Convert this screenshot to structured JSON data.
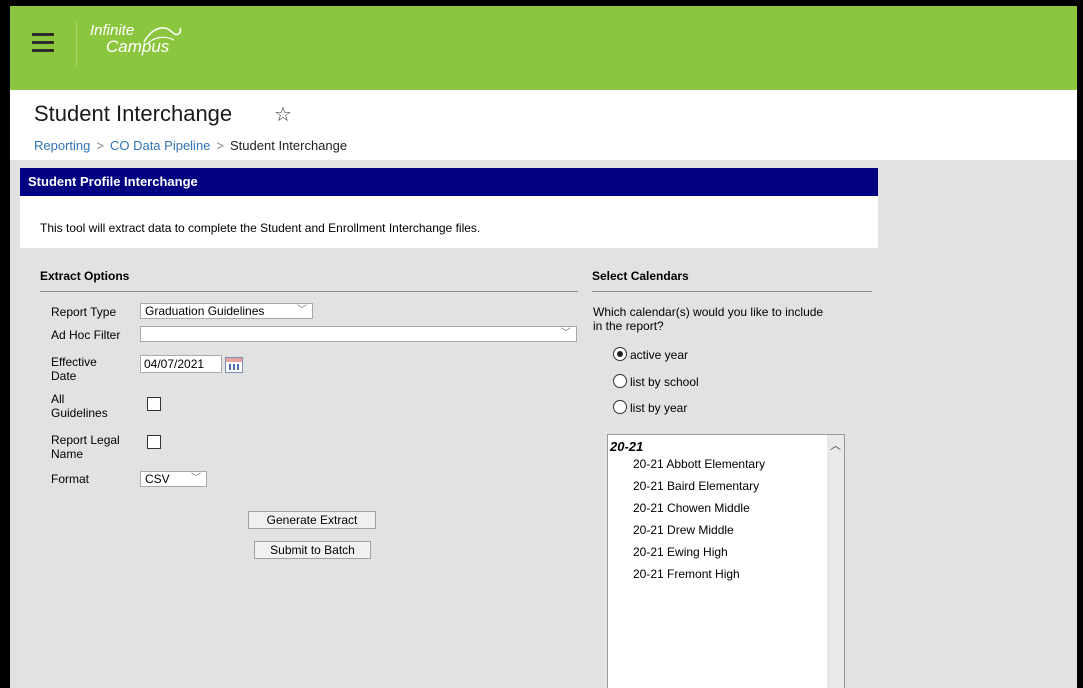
{
  "app": {
    "logo_line1": "Infinite",
    "logo_line2": "Campus"
  },
  "header": {
    "title": "Student Interchange",
    "breadcrumb": [
      "Reporting",
      "CO Data Pipeline",
      "Student Interchange"
    ]
  },
  "panel": {
    "title": "Student Profile Interchange",
    "description": "This tool will extract data to complete the Student and Enrollment Interchange files."
  },
  "extract_options": {
    "title": "Extract Options",
    "report_type_label": "Report Type",
    "report_type_value": "Graduation Guidelines",
    "ad_hoc_label": "Ad Hoc Filter",
    "ad_hoc_value": "",
    "effective_date_label_1": "Effective",
    "effective_date_label_2": "Date",
    "effective_date_value": "04/07/2021",
    "all_guidelines_label_1": "All",
    "all_guidelines_label_2": "Guidelines",
    "report_legal_label_1": "Report Legal",
    "report_legal_label_2": "Name",
    "format_label": "Format",
    "format_value": "CSV",
    "generate_button": "Generate Extract",
    "submit_button": "Submit to Batch"
  },
  "calendars": {
    "title": "Select Calendars",
    "question_line1": "Which calendar(s) would you like to include",
    "question_line2": "in the report?",
    "options": [
      "active year",
      "list by school",
      "list by year"
    ],
    "group": "20-21",
    "items": [
      "20-21 Abbott Elementary",
      "20-21 Baird Elementary",
      "20-21 Chowen Middle",
      "20-21 Drew Middle",
      "20-21 Ewing High",
      "20-21 Fremont High"
    ]
  }
}
